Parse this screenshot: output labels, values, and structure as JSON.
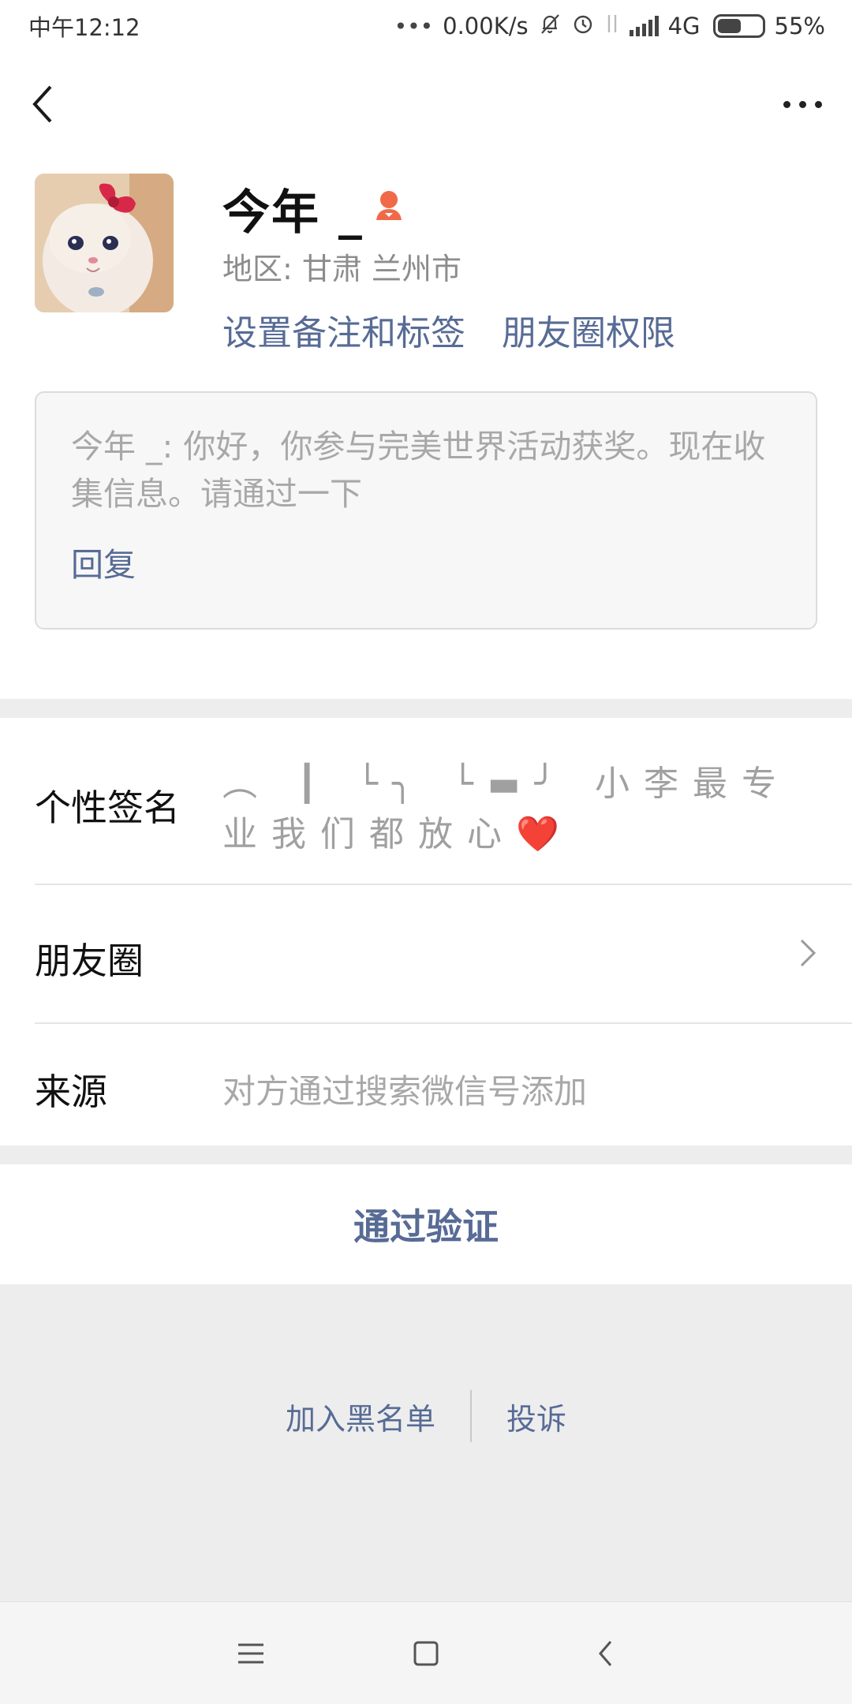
{
  "status_bar": {
    "time": "中午12:12",
    "net_speed": "0.00K/s",
    "network": "4G",
    "battery": "55%",
    "battery_level": 0.55
  },
  "profile": {
    "name": "今年 _",
    "region": "地区:  甘肃  兰州市",
    "set_remark_label": "设置备注和标签",
    "moments_permission_label": "朋友圈权限",
    "gender_icon": "female-icon"
  },
  "message": {
    "text": "今年 _: 你好，你参与完美世界活动获奖。现在收集信息。请通过一下",
    "reply_label": "回复"
  },
  "info": {
    "signature_label": "个性签名",
    "signature_value": "︵ ┃ └╮ └▬╯ 小李最专业我们都放心",
    "signature_emoji": "❤️",
    "moments_label": "朋友圈",
    "source_label": "来源",
    "source_value": "对方通过搜索微信号添加"
  },
  "actions": {
    "verify_label": "通过验证",
    "blacklist_label": "加入黑名单",
    "report_label": "投诉"
  },
  "colors": {
    "link": "#576b95",
    "gender": "#f06a4a"
  }
}
